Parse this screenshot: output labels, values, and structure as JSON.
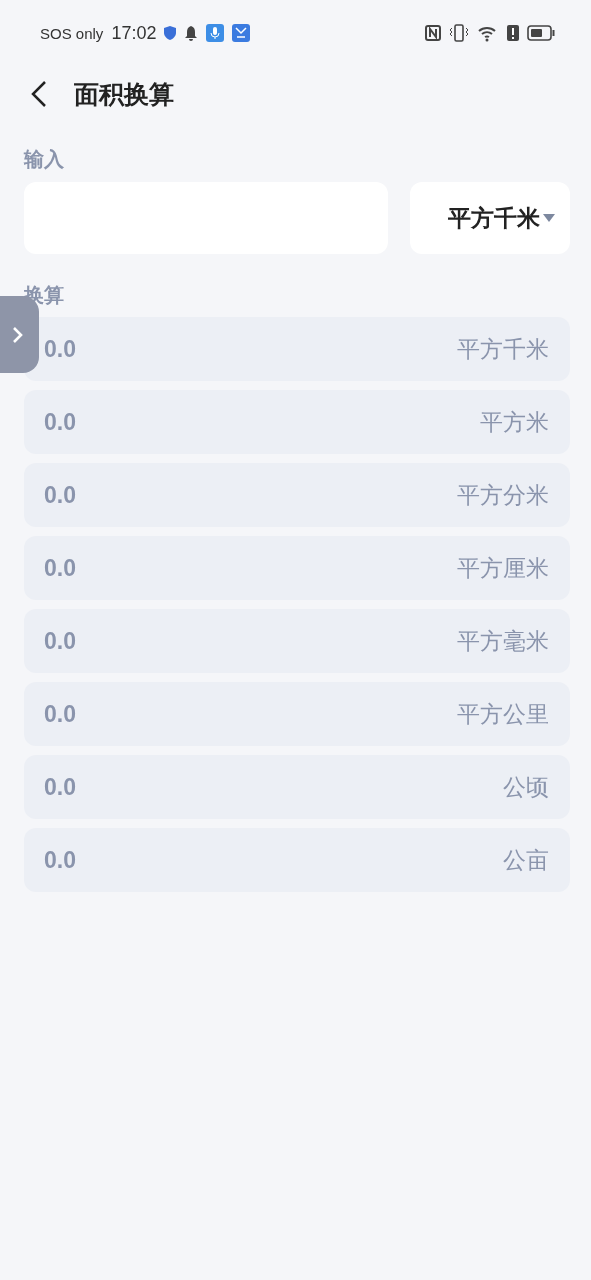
{
  "status_bar": {
    "carrier": "SOS only",
    "time": "17:02"
  },
  "header": {
    "title": "面积换算"
  },
  "input_section": {
    "label": "输入",
    "unit_select": {
      "value": "平方千米"
    }
  },
  "results_section": {
    "label": "换算",
    "rows": [
      {
        "value": "0.0",
        "unit": "平方千米"
      },
      {
        "value": "0.0",
        "unit": "平方米"
      },
      {
        "value": "0.0",
        "unit": "平方分米"
      },
      {
        "value": "0.0",
        "unit": "平方厘米"
      },
      {
        "value": "0.0",
        "unit": "平方毫米"
      },
      {
        "value": "0.0",
        "unit": "平方公里"
      },
      {
        "value": "0.0",
        "unit": "公顷"
      },
      {
        "value": "0.0",
        "unit": "公亩"
      }
    ]
  }
}
